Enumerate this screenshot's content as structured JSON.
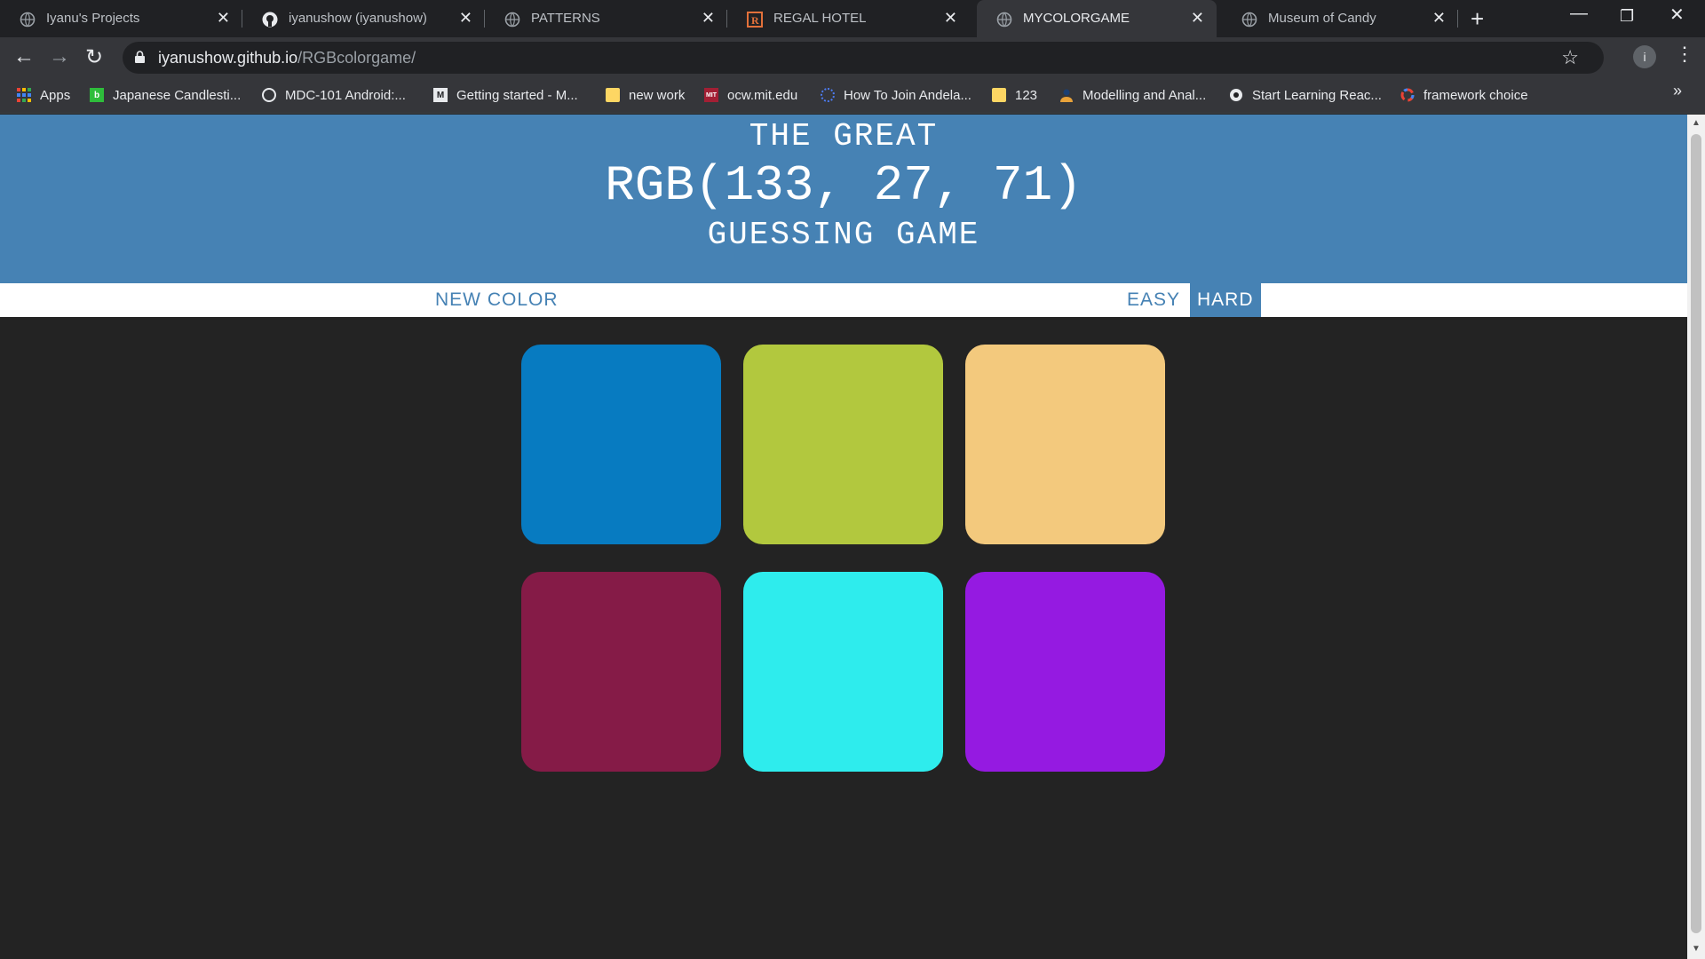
{
  "tabs": [
    {
      "title": "Iyanu's Projects",
      "icon": "globe-icon"
    },
    {
      "title": "iyanushow (iyanushow)",
      "icon": "github-icon"
    },
    {
      "title": "PATTERNS",
      "icon": "globe-icon"
    },
    {
      "title": "REGAL HOTEL",
      "icon": "regal-r-icon"
    },
    {
      "title": "MYCOLORGAME",
      "icon": "globe-icon",
      "active": true
    },
    {
      "title": "Museum of Candy",
      "icon": "globe-icon"
    }
  ],
  "browser": {
    "url_host": "iyanushow.github.io",
    "url_path": "/RGBcolorgame/",
    "profile_initial": "i"
  },
  "bookmarks": [
    {
      "label": "Apps",
      "icon": "apps-grid-icon"
    },
    {
      "label": "Japanese Candlesti...",
      "icon": "b-icon"
    },
    {
      "label": "MDC-101 Android:...",
      "icon": "codelabs-icon"
    },
    {
      "label": "Getting started - M...",
      "icon": "medium-icon"
    },
    {
      "label": "new work",
      "icon": "folder-icon"
    },
    {
      "label": "ocw.mit.edu",
      "icon": "mit-ocw-icon"
    },
    {
      "label": "How To Join Andela...",
      "icon": "andela-icon"
    },
    {
      "label": "123",
      "icon": "folder-icon"
    },
    {
      "label": "Modelling and Anal...",
      "icon": "person-icon"
    },
    {
      "label": "Start Learning Reac...",
      "icon": "react-icon"
    },
    {
      "label": "framework choice",
      "icon": "circle-icon"
    }
  ],
  "game": {
    "title_top": "THE GREAT",
    "target_rgb": "RGB(133, 27, 71)",
    "title_bottom": "GUESSING GAME",
    "new_color_label": "NEW COLOR",
    "easy_label": "EASY",
    "hard_label": "HARD",
    "selected_mode": "HARD",
    "header_color": "#4682b4",
    "background_color": "#232323",
    "squares": [
      "#077bc1",
      "#b2c83e",
      "#f3c97d",
      "#851b47",
      "#2eeced",
      "#951ae1"
    ]
  }
}
